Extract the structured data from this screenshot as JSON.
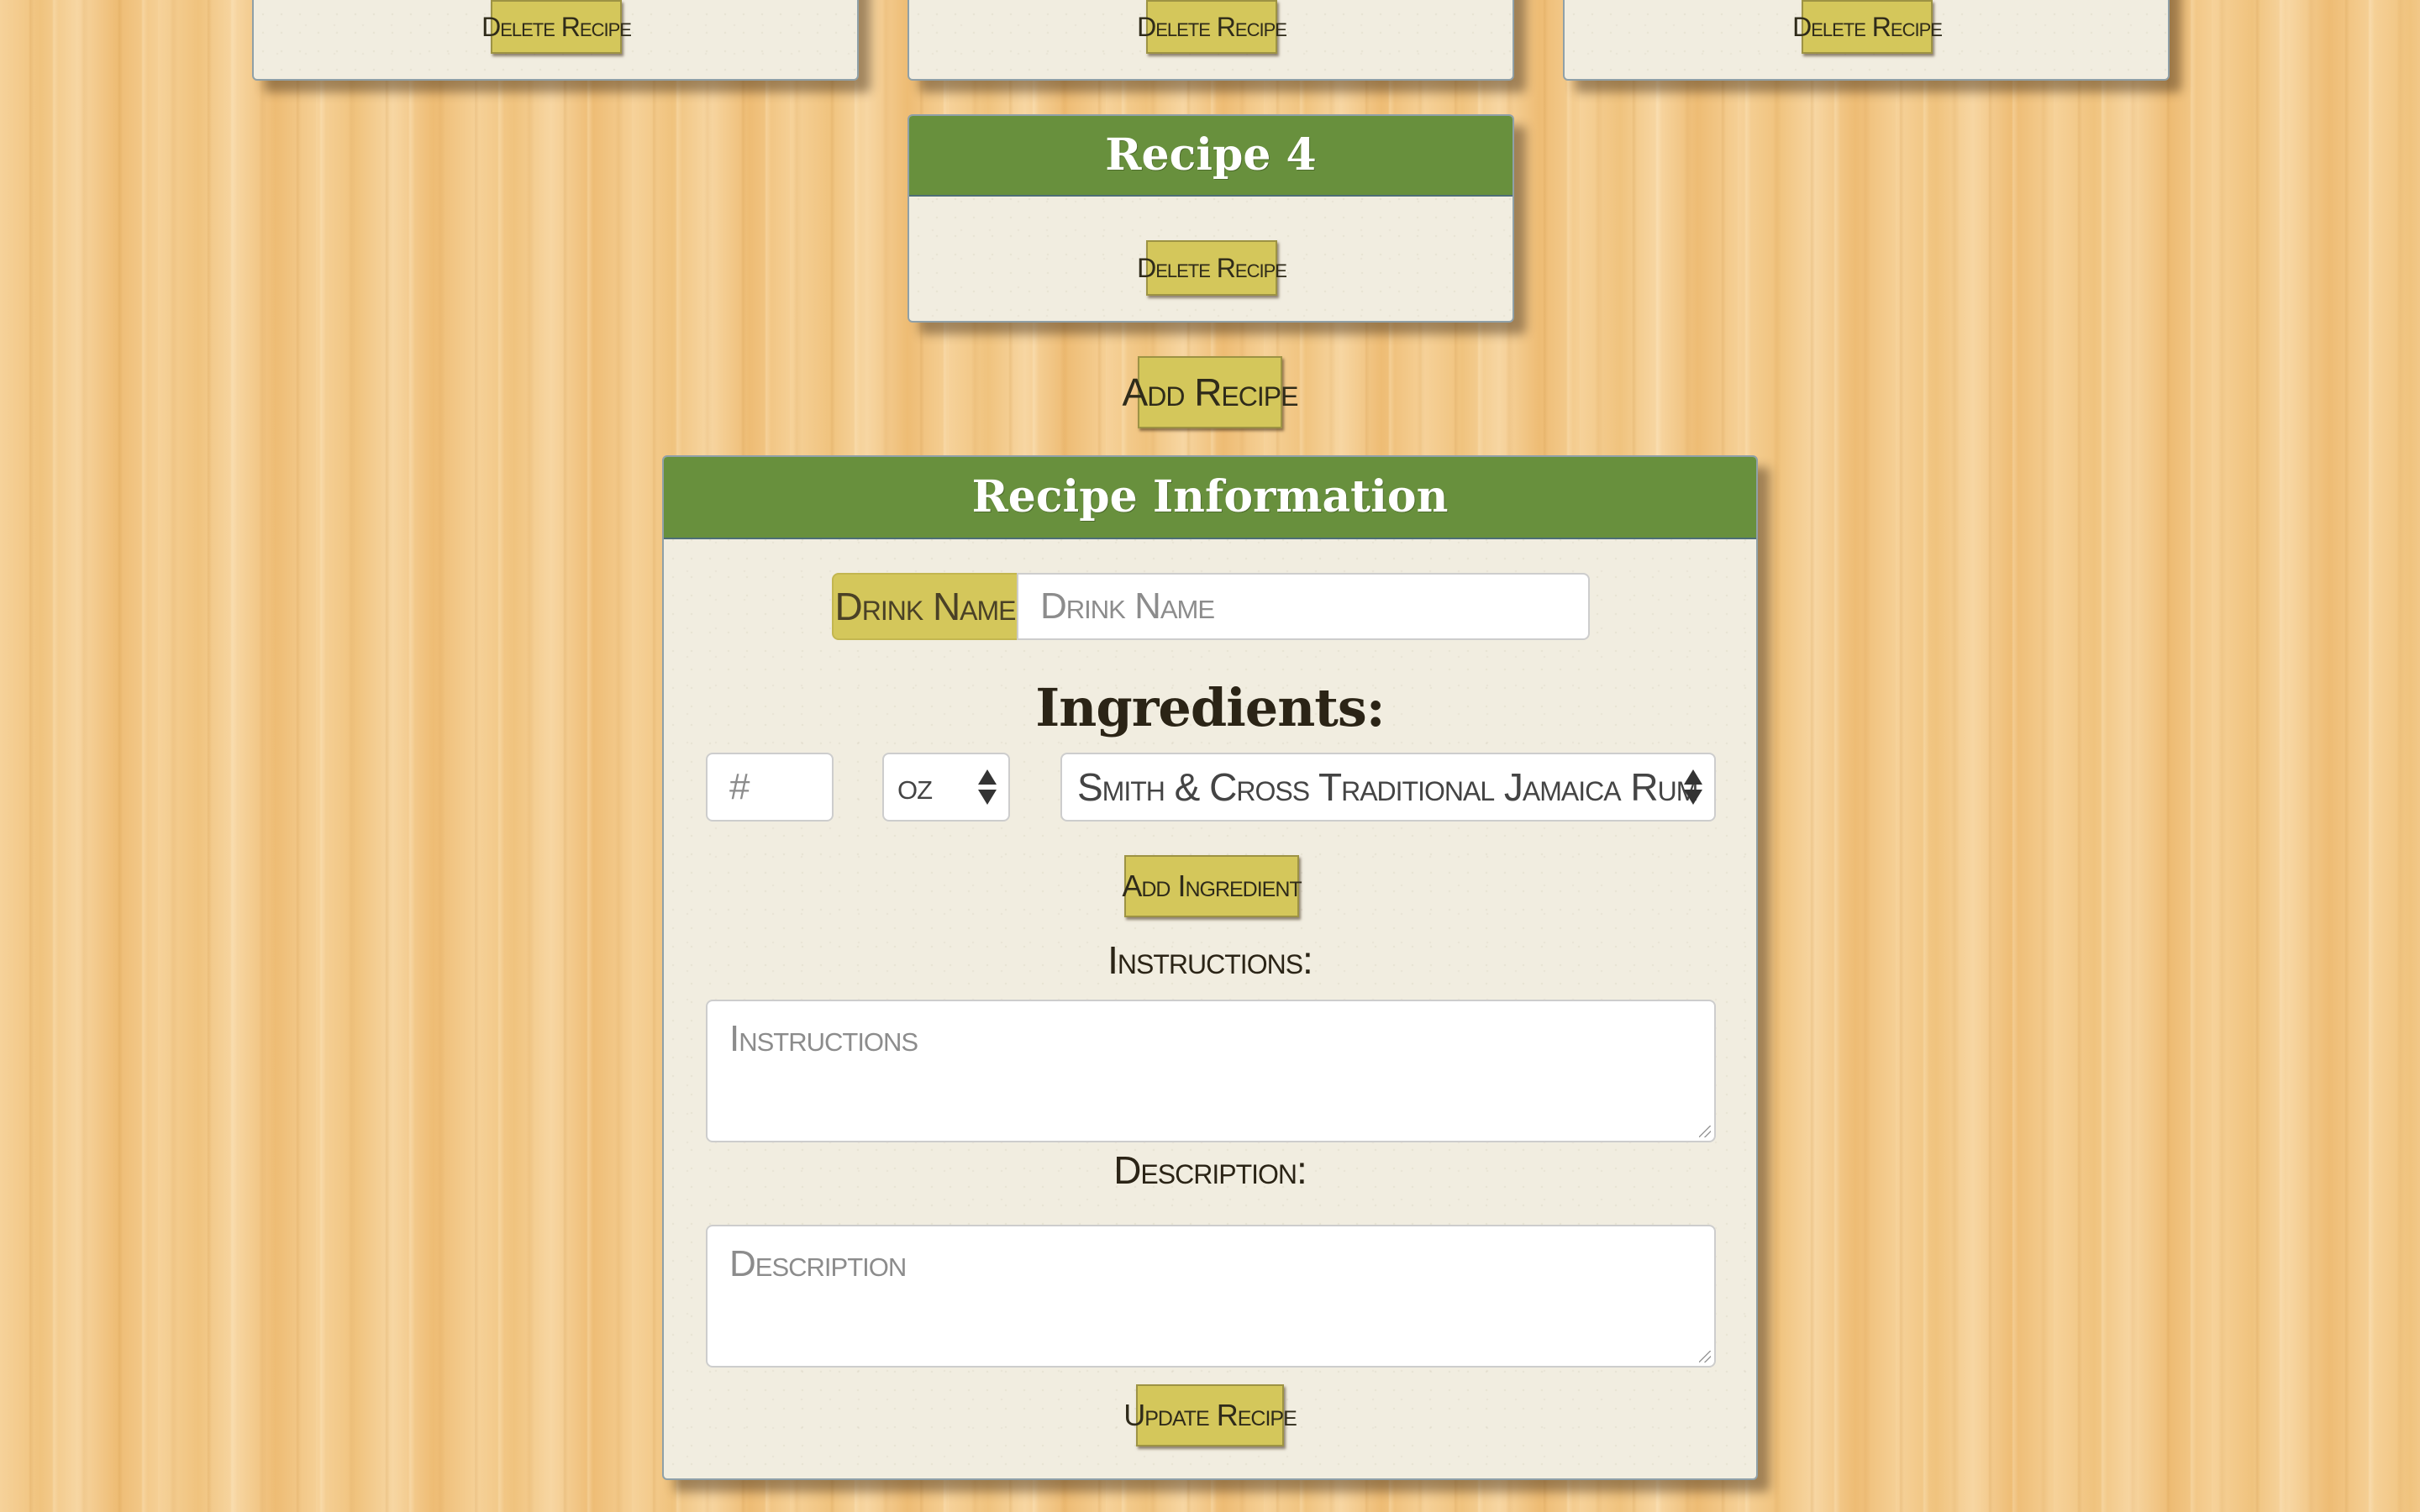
{
  "top_cards": [
    {
      "delete_label": "Delete Recipe"
    },
    {
      "delete_label": "Delete Recipe"
    },
    {
      "delete_label": "Delete Recipe"
    }
  ],
  "recipe_card": {
    "title": "Recipe 4",
    "delete_label": "Delete Recipe"
  },
  "add_recipe_label": "Add Recipe",
  "info_panel": {
    "title": "Recipe Information",
    "drink_name": {
      "label": "Drink Name",
      "placeholder": "Drink Name",
      "value": ""
    },
    "ingredients_heading": "Ingredients:",
    "amount_placeholder": "#",
    "unit_selected": "oz",
    "ingredient_selected": "Smith & Cross Traditional Jamaica Rum",
    "add_ingredient_label": "Add Ingredient",
    "instructions_label": "Instructions:",
    "instructions_placeholder": "Instructions",
    "description_label": "Description:",
    "description_placeholder": "Description",
    "update_label": "Update Recipe"
  },
  "colors": {
    "header_green": "#68903d",
    "button_gold": "#d4c75b",
    "card_paper": "#f1ede0",
    "wood": "#f3c98a"
  }
}
